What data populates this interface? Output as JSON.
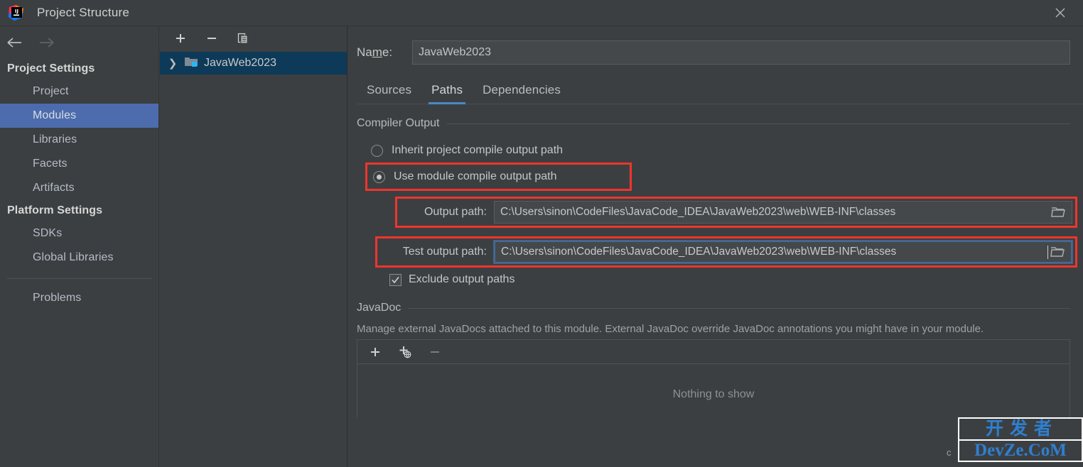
{
  "window": {
    "title": "Project Structure",
    "logo_icon": "intellij-idea-logo",
    "close_icon": "close-icon"
  },
  "sidebar": {
    "back_icon": "arrow-left-icon",
    "forward_icon": "arrow-right-icon",
    "groups": [
      {
        "label": "Project Settings",
        "items": [
          {
            "label": "Project",
            "selected": false
          },
          {
            "label": "Modules",
            "selected": true
          },
          {
            "label": "Libraries",
            "selected": false
          },
          {
            "label": "Facets",
            "selected": false
          },
          {
            "label": "Artifacts",
            "selected": false
          }
        ]
      },
      {
        "label": "Platform Settings",
        "items": [
          {
            "label": "SDKs",
            "selected": false
          },
          {
            "label": "Global Libraries",
            "selected": false
          }
        ]
      }
    ],
    "problems_label": "Problems"
  },
  "modules_panel": {
    "toolbar": {
      "add_icon": "plus-icon",
      "remove_icon": "minus-icon",
      "copy_icon": "copy-icon"
    },
    "tree": [
      {
        "label": "JavaWeb2023",
        "expand_icon": "chevron-right-icon",
        "module_icon": "module-folder-icon",
        "selected": true
      }
    ]
  },
  "editor": {
    "name_label_prefix": "Na",
    "name_label_mnemonic": "m",
    "name_label_suffix": "e:",
    "name_value": "JavaWeb2023",
    "tabs": [
      {
        "label": "Sources",
        "active": false
      },
      {
        "label": "Paths",
        "active": true
      },
      {
        "label": "Dependencies",
        "active": false
      }
    ],
    "compiler_output": {
      "group_label": "Compiler Output",
      "inherit_label": "Inherit project compile output path",
      "inherit_selected": false,
      "use_module_label": "Use module compile output path",
      "use_module_selected": true,
      "output_path_label": "Output path:",
      "output_path_value": "C:\\Users\\sinon\\CodeFiles\\JavaCode_IDEA\\JavaWeb2023\\web\\WEB-INF\\classes",
      "test_output_path_label": "Test output path:",
      "test_output_path_value": "C:\\Users\\sinon\\CodeFiles\\JavaCode_IDEA\\JavaWeb2023\\web\\WEB-INF\\classes",
      "browse_icon": "folder-browse-icon",
      "exclude_label": "Exclude output paths",
      "exclude_checked": true
    },
    "javadoc": {
      "group_label": "JavaDoc",
      "description": "Manage external JavaDocs attached to this module. External JavaDoc override JavaDoc annotations you might have in your module.",
      "toolbar": {
        "add_icon": "plus-icon",
        "add_url_icon": "plus-globe-icon",
        "remove_icon": "minus-icon"
      },
      "empty_text": "Nothing to show"
    }
  },
  "watermark": {
    "cn_text": "开发者",
    "en_text": "DevZe.CoM",
    "prefix": "c"
  },
  "colors": {
    "window_bg": "#3c3f41",
    "sidebar_selection": "#4c6cad",
    "tree_selection": "#0d3a58",
    "tab_underline": "#4a88c7",
    "highlight_box": "#f0342e",
    "field_bg": "#45484a",
    "focus_border": "#466a94"
  }
}
